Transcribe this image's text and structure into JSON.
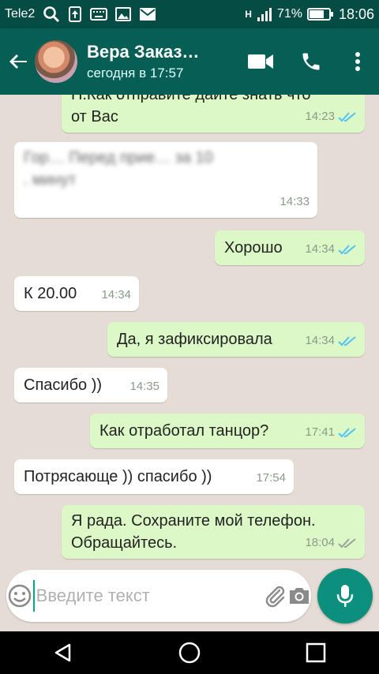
{
  "status_bar": {
    "carrier": "Tele2",
    "network": "H",
    "battery": "71%",
    "time": "18:06"
  },
  "header": {
    "contact_name": "Вера Заказ…",
    "contact_status": "сегодня в 17:57"
  },
  "messages": [
    {
      "dir": "out",
      "text": "П.Как отправите дайте знать что\nот Вас",
      "time": "14:23",
      "ticks": "read"
    },
    {
      "dir": "in",
      "text": "Гор… Перед прие… за 10\n. минут",
      "time": "14:33"
    },
    {
      "dir": "out",
      "text": "Хорошо",
      "time": "14:34",
      "ticks": "read"
    },
    {
      "dir": "in",
      "text": "К 20.00",
      "time": "14:34"
    },
    {
      "dir": "out",
      "text": "Да, я зафиксировала",
      "time": "14:34",
      "ticks": "read"
    },
    {
      "dir": "in",
      "text": "Спасибо ))",
      "time": "14:35"
    },
    {
      "dir": "out",
      "text": "Как отработал танцор?",
      "time": "17:41",
      "ticks": "read"
    },
    {
      "dir": "in",
      "text": "Потрясающе )) спасибо ))",
      "time": "17:54"
    },
    {
      "dir": "out",
      "text": "Я рада. Сохраните мой телефон.\nОбращайтесь.",
      "time": "18:04",
      "ticks": "delivered"
    }
  ],
  "composer": {
    "placeholder": "Введите текст"
  },
  "colors": {
    "header": "#075e54",
    "status_bar": "#054d44",
    "outgoing_bubble": "#dcf8c6",
    "incoming_bubble": "#ffffff",
    "accent": "#0c8f7c",
    "read_ticks": "#4fc3f7"
  }
}
